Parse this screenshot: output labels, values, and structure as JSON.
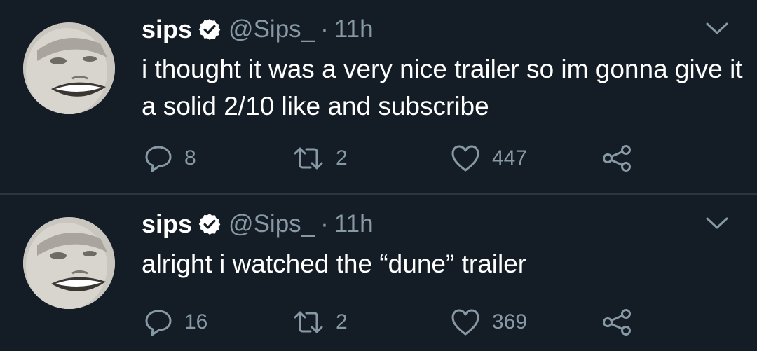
{
  "tweets": [
    {
      "name": "sips",
      "handle": "@Sips_",
      "separator": "·",
      "time": "11h",
      "text": "i thought it was a very nice trailer so im gonna give it a solid 2/10 like and subscribe",
      "replies": "8",
      "retweets": "2",
      "likes": "447"
    },
    {
      "name": "sips",
      "handle": "@Sips_",
      "separator": "·",
      "time": "11h",
      "text": "alright i watched the “dune” trailer",
      "replies": "16",
      "retweets": "2",
      "likes": "369"
    }
  ],
  "colors": {
    "background": "#141d26",
    "secondary_text": "#8899a6",
    "divider": "#2b3640"
  },
  "icons": [
    "verified-badge-icon",
    "chevron-down-icon",
    "reply-icon",
    "retweet-icon",
    "like-icon",
    "share-icon"
  ]
}
